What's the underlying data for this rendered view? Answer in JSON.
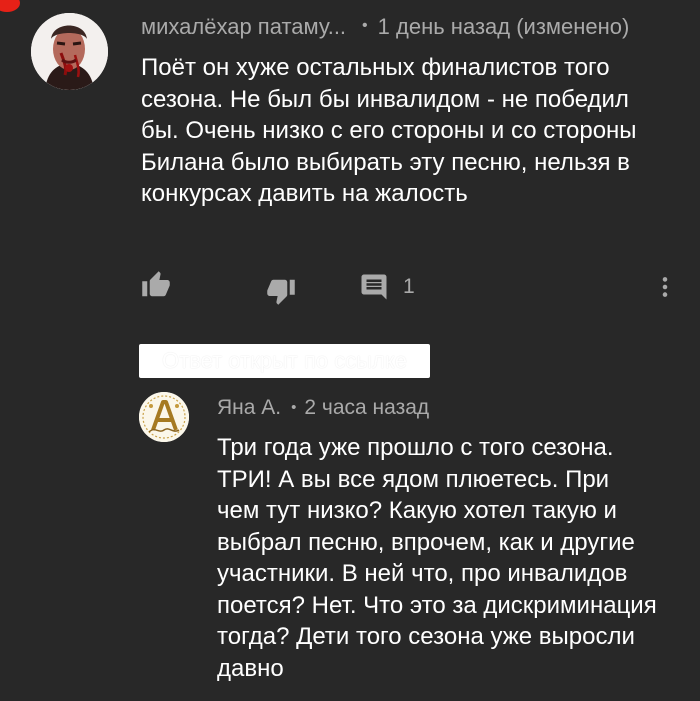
{
  "comment": {
    "author": "михалёхар патаму...",
    "time": "1 день назад (изменено)",
    "text": "Поёт он хуже остальных финалистов того сезона. Не был бы инвалидом - не победил бы. Очень низко с его стороны и со стороны Билана было выбирать эту песню, нельзя в конкурсах давить на жалость",
    "reply_count": "1",
    "icons": {
      "like": "thumbs-up-icon",
      "dislike": "thumbs-down-icon",
      "reply": "comment-icon",
      "menu": "more-vert-icon"
    }
  },
  "linked_badge": "Ответ открыт по ссылке",
  "reply": {
    "author": "Яна А.",
    "time": "2 часа назад",
    "text": "Три года уже прошло с того сезона. ТРИ! А вы все ядом плюетесь. При чем тут низко? Какую хотел такую и выбрал песню, впрочем, как и другие участники. В ней что, про инвалидов поется? Нет. Что это за дискриминация тогда? Дети того сезона уже выросли давно"
  },
  "colors": {
    "background": "#282828",
    "text": "#ffffff",
    "secondary_text": "#aaaaaa",
    "badge": "#ffffff",
    "notification": "#e62117"
  }
}
